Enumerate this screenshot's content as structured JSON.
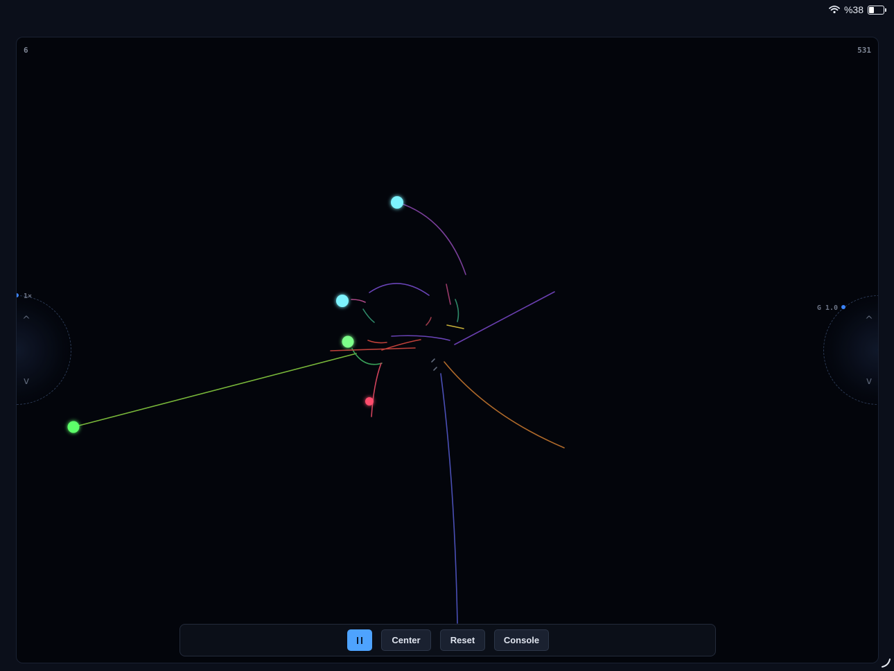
{
  "status": {
    "battery_text": "%38",
    "battery_level": 0.38,
    "wifi_icon": "wifi-icon"
  },
  "sim": {
    "top_left_value": "6",
    "top_right_value": "531",
    "left_dial": {
      "label": "1×",
      "up": "^",
      "down": "v"
    },
    "right_dial": {
      "label": "G 1.0",
      "up": "^",
      "down": "v"
    },
    "colors": {
      "background": "#03050b",
      "accent": "#4ea3ff",
      "cyan_body": "#7df3ff",
      "green_body": "#5dff6a",
      "red_body": "#ff4d6d"
    }
  },
  "toolbar": {
    "pause_icon": "pause-icon",
    "center_label": "Center",
    "reset_label": "Reset",
    "console_label": "Console"
  }
}
